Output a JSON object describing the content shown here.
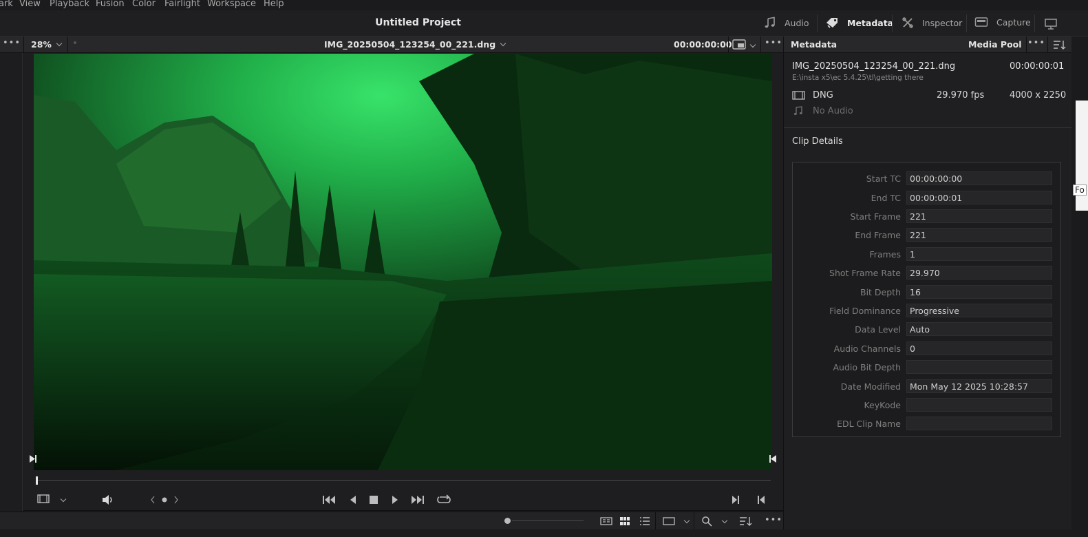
{
  "menu": {
    "items": [
      "ark",
      "View",
      "Playback",
      "Fusion",
      "Color",
      "Fairlight",
      "Workspace",
      "Help"
    ]
  },
  "title": {
    "project": "Untitled Project"
  },
  "panels": {
    "audio": "Audio",
    "metadata": "Metadata",
    "inspector": "Inspector",
    "capture": "Capture"
  },
  "viewer": {
    "zoom": "28%",
    "clip_name": "IMG_20250504_123254_00_221.dng",
    "timecode": "00:00:00:00",
    "menu_dots": "•••",
    "scrub_progress": 0.0
  },
  "metadata": {
    "header_left": "Metadata",
    "header_right": "Media Pool",
    "clip_name": "IMG_20250504_123254_00_221.dng",
    "clip_tc": "00:00:00:01",
    "path": "E:\\insta x5\\ec 5.4.25\\tl\\getting there",
    "format": "DNG",
    "fps": "29.970 fps",
    "resolution": "4000 x 2250",
    "audio": "No Audio",
    "details_title": "Clip Details",
    "details": [
      {
        "label": "Start TC",
        "value": "00:00:00:00"
      },
      {
        "label": "End TC",
        "value": "00:00:00:01"
      },
      {
        "label": "Start Frame",
        "value": "221"
      },
      {
        "label": "End Frame",
        "value": "221"
      },
      {
        "label": "Frames",
        "value": "1"
      },
      {
        "label": "Shot Frame Rate",
        "value": "29.970"
      },
      {
        "label": "Bit Depth",
        "value": "16"
      },
      {
        "label": "Field Dominance",
        "value": "Progressive"
      },
      {
        "label": "Data Level",
        "value": "Auto"
      },
      {
        "label": "Audio Channels",
        "value": "0"
      },
      {
        "label": "Audio Bit Depth",
        "value": ""
      },
      {
        "label": "Date Modified",
        "value": "Mon May 12 2025 10:28:57"
      },
      {
        "label": "KeyKode",
        "value": ""
      },
      {
        "label": "EDL Clip Name",
        "value": ""
      }
    ]
  },
  "edge": {
    "text": "Fo"
  },
  "colors": {
    "image_tint": "#1f9a3a",
    "bg": "#1b1b1d",
    "panel": "#1f1f21"
  }
}
